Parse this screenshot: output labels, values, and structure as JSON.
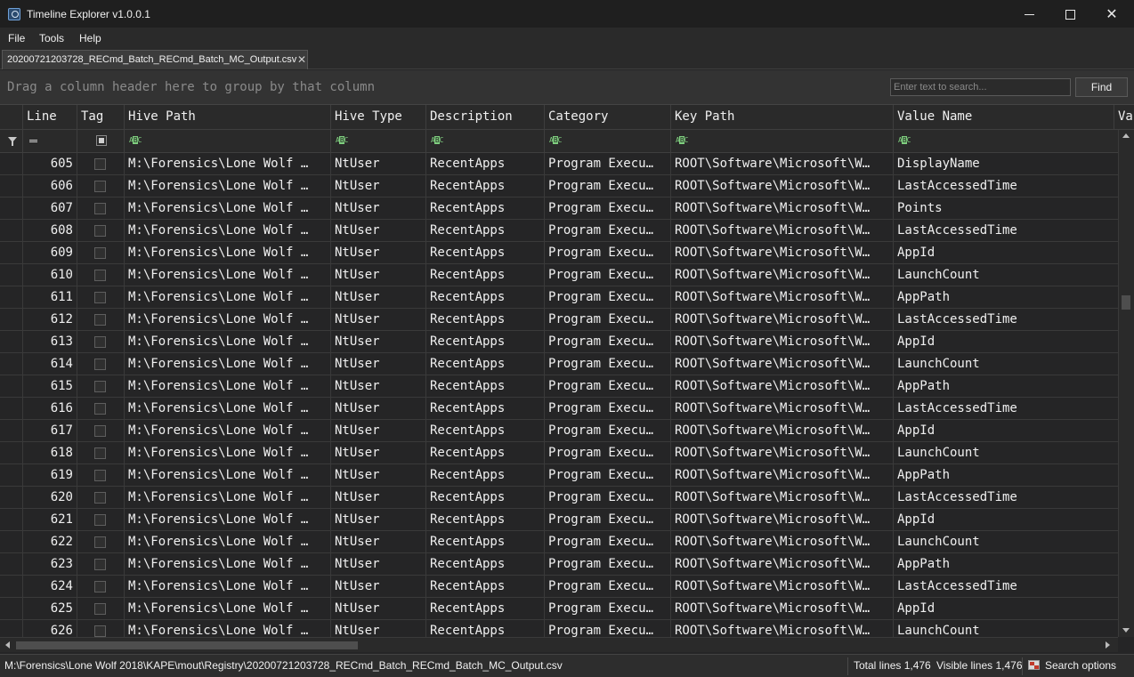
{
  "window": {
    "title": "Timeline Explorer v1.0.0.1",
    "minimize_symbol": "",
    "close_symbol": "✕"
  },
  "menu": {
    "items": [
      "File",
      "Tools",
      "Help"
    ]
  },
  "tab": {
    "label": "20200721203728_RECmd_Batch_RECmd_Batch_MC_Output.csv",
    "close_symbol": "✕"
  },
  "toolbar": {
    "group_hint": "Drag a column header here to group by that column",
    "search_placeholder": "Enter text to search...",
    "find_label": "Find"
  },
  "grid": {
    "columns": [
      "Line",
      "Tag",
      "Hive Path",
      "Hive Type",
      "Description",
      "Category",
      "Key Path",
      "Value Name",
      "Va"
    ],
    "rows": [
      {
        "line": "605",
        "hive_path": "M:\\Forensics\\Lone Wolf …",
        "hive_type": "NtUser",
        "description": "RecentApps",
        "category": "Program Execu…",
        "key_path": "ROOT\\Software\\Microsoft\\W…",
        "value_name": "DisplayName"
      },
      {
        "line": "606",
        "hive_path": "M:\\Forensics\\Lone Wolf …",
        "hive_type": "NtUser",
        "description": "RecentApps",
        "category": "Program Execu…",
        "key_path": "ROOT\\Software\\Microsoft\\W…",
        "value_name": "LastAccessedTime"
      },
      {
        "line": "607",
        "hive_path": "M:\\Forensics\\Lone Wolf …",
        "hive_type": "NtUser",
        "description": "RecentApps",
        "category": "Program Execu…",
        "key_path": "ROOT\\Software\\Microsoft\\W…",
        "value_name": "Points"
      },
      {
        "line": "608",
        "hive_path": "M:\\Forensics\\Lone Wolf …",
        "hive_type": "NtUser",
        "description": "RecentApps",
        "category": "Program Execu…",
        "key_path": "ROOT\\Software\\Microsoft\\W…",
        "value_name": "LastAccessedTime"
      },
      {
        "line": "609",
        "hive_path": "M:\\Forensics\\Lone Wolf …",
        "hive_type": "NtUser",
        "description": "RecentApps",
        "category": "Program Execu…",
        "key_path": "ROOT\\Software\\Microsoft\\W…",
        "value_name": "AppId"
      },
      {
        "line": "610",
        "hive_path": "M:\\Forensics\\Lone Wolf …",
        "hive_type": "NtUser",
        "description": "RecentApps",
        "category": "Program Execu…",
        "key_path": "ROOT\\Software\\Microsoft\\W…",
        "value_name": "LaunchCount"
      },
      {
        "line": "611",
        "hive_path": "M:\\Forensics\\Lone Wolf …",
        "hive_type": "NtUser",
        "description": "RecentApps",
        "category": "Program Execu…",
        "key_path": "ROOT\\Software\\Microsoft\\W…",
        "value_name": "AppPath"
      },
      {
        "line": "612",
        "hive_path": "M:\\Forensics\\Lone Wolf …",
        "hive_type": "NtUser",
        "description": "RecentApps",
        "category": "Program Execu…",
        "key_path": "ROOT\\Software\\Microsoft\\W…",
        "value_name": "LastAccessedTime"
      },
      {
        "line": "613",
        "hive_path": "M:\\Forensics\\Lone Wolf …",
        "hive_type": "NtUser",
        "description": "RecentApps",
        "category": "Program Execu…",
        "key_path": "ROOT\\Software\\Microsoft\\W…",
        "value_name": "AppId"
      },
      {
        "line": "614",
        "hive_path": "M:\\Forensics\\Lone Wolf …",
        "hive_type": "NtUser",
        "description": "RecentApps",
        "category": "Program Execu…",
        "key_path": "ROOT\\Software\\Microsoft\\W…",
        "value_name": "LaunchCount"
      },
      {
        "line": "615",
        "hive_path": "M:\\Forensics\\Lone Wolf …",
        "hive_type": "NtUser",
        "description": "RecentApps",
        "category": "Program Execu…",
        "key_path": "ROOT\\Software\\Microsoft\\W…",
        "value_name": "AppPath"
      },
      {
        "line": "616",
        "hive_path": "M:\\Forensics\\Lone Wolf …",
        "hive_type": "NtUser",
        "description": "RecentApps",
        "category": "Program Execu…",
        "key_path": "ROOT\\Software\\Microsoft\\W…",
        "value_name": "LastAccessedTime"
      },
      {
        "line": "617",
        "hive_path": "M:\\Forensics\\Lone Wolf …",
        "hive_type": "NtUser",
        "description": "RecentApps",
        "category": "Program Execu…",
        "key_path": "ROOT\\Software\\Microsoft\\W…",
        "value_name": "AppId"
      },
      {
        "line": "618",
        "hive_path": "M:\\Forensics\\Lone Wolf …",
        "hive_type": "NtUser",
        "description": "RecentApps",
        "category": "Program Execu…",
        "key_path": "ROOT\\Software\\Microsoft\\W…",
        "value_name": "LaunchCount"
      },
      {
        "line": "619",
        "hive_path": "M:\\Forensics\\Lone Wolf …",
        "hive_type": "NtUser",
        "description": "RecentApps",
        "category": "Program Execu…",
        "key_path": "ROOT\\Software\\Microsoft\\W…",
        "value_name": "AppPath"
      },
      {
        "line": "620",
        "hive_path": "M:\\Forensics\\Lone Wolf …",
        "hive_type": "NtUser",
        "description": "RecentApps",
        "category": "Program Execu…",
        "key_path": "ROOT\\Software\\Microsoft\\W…",
        "value_name": "LastAccessedTime"
      },
      {
        "line": "621",
        "hive_path": "M:\\Forensics\\Lone Wolf …",
        "hive_type": "NtUser",
        "description": "RecentApps",
        "category": "Program Execu…",
        "key_path": "ROOT\\Software\\Microsoft\\W…",
        "value_name": "AppId"
      },
      {
        "line": "622",
        "hive_path": "M:\\Forensics\\Lone Wolf …",
        "hive_type": "NtUser",
        "description": "RecentApps",
        "category": "Program Execu…",
        "key_path": "ROOT\\Software\\Microsoft\\W…",
        "value_name": "LaunchCount"
      },
      {
        "line": "623",
        "hive_path": "M:\\Forensics\\Lone Wolf …",
        "hive_type": "NtUser",
        "description": "RecentApps",
        "category": "Program Execu…",
        "key_path": "ROOT\\Software\\Microsoft\\W…",
        "value_name": "AppPath"
      },
      {
        "line": "624",
        "hive_path": "M:\\Forensics\\Lone Wolf …",
        "hive_type": "NtUser",
        "description": "RecentApps",
        "category": "Program Execu…",
        "key_path": "ROOT\\Software\\Microsoft\\W…",
        "value_name": "LastAccessedTime"
      },
      {
        "line": "625",
        "hive_path": "M:\\Forensics\\Lone Wolf …",
        "hive_type": "NtUser",
        "description": "RecentApps",
        "category": "Program Execu…",
        "key_path": "ROOT\\Software\\Microsoft\\W…",
        "value_name": "AppId"
      },
      {
        "line": "626",
        "hive_path": "M:\\Forensics\\Lone Wolf …",
        "hive_type": "NtUser",
        "description": "RecentApps",
        "category": "Program Execu…",
        "key_path": "ROOT\\Software\\Microsoft\\W…",
        "value_name": "LaunchCount"
      }
    ]
  },
  "status": {
    "file_path": "M:\\Forensics\\Lone Wolf 2018\\KAPE\\mout\\Registry\\20200721203728_RECmd_Batch_RECmd_Batch_MC_Output.csv",
    "total_lines": "Total lines 1,476",
    "visible_lines": "Visible lines 1,476",
    "search_options": "Search options"
  },
  "icons": {
    "app": "timeline-app-icon",
    "filter": "funnel-icon",
    "equals": "equals-icon",
    "text_filter": "abc-icon",
    "search_options": "search-options-icon"
  },
  "colors": {
    "background": "#252526",
    "titlebar": "#1f1f1f",
    "text": "#f0f0f0",
    "filter_icon": "#7fcf7f"
  }
}
